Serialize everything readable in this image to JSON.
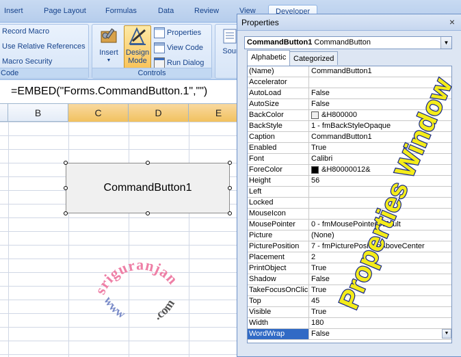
{
  "ribbon": {
    "tabs": [
      "Insert",
      "Page Layout",
      "Formulas",
      "Data",
      "Review",
      "View",
      "Developer"
    ],
    "active_tab": "Developer",
    "code_group": {
      "label": "Code",
      "record_macro": "Record Macro",
      "relative_refs": "Use Relative References",
      "macro_security": "Macro Security"
    },
    "controls_group": {
      "label": "Controls",
      "insert": "Insert",
      "design_mode_line1": "Design",
      "design_mode_line2": "Mode",
      "properties": "Properties",
      "view_code": "View Code",
      "run_dialog": "Run Dialog"
    },
    "source_partial": "Sour"
  },
  "formula_bar": {
    "formula": "=EMBED(\"Forms.CommandButton.1\",\"\")"
  },
  "columns": [
    "B",
    "C",
    "D",
    "E"
  ],
  "sheet": {
    "command_button_label": "CommandButton1",
    "watermark_top": "sriguranjani",
    "watermark_left": "www",
    "watermark_right": ".com"
  },
  "properties_window": {
    "title": "Properties",
    "close_glyph": "×",
    "object_name": "CommandButton1",
    "object_type": "CommandButton",
    "tabs": [
      "Alphabetic",
      "Categorized"
    ],
    "active_tab": "Alphabetic",
    "overlay_text": "Properties Window",
    "rows": [
      {
        "name": "(Name)",
        "value": "CommandButton1"
      },
      {
        "name": "Accelerator",
        "value": ""
      },
      {
        "name": "AutoLoad",
        "value": "False"
      },
      {
        "name": "AutoSize",
        "value": "False"
      },
      {
        "name": "BackColor",
        "value": "&H800000",
        "swatch": "#f0f0f0"
      },
      {
        "name": "BackStyle",
        "value": "1 - fmBackStyleOpaque"
      },
      {
        "name": "Caption",
        "value": "CommandButton1"
      },
      {
        "name": "Enabled",
        "value": "True"
      },
      {
        "name": "Font",
        "value": "Calibri"
      },
      {
        "name": "ForeColor",
        "value": "&H80000012&",
        "swatch": "#000000"
      },
      {
        "name": "Height",
        "value": "56"
      },
      {
        "name": "Left",
        "value": ""
      },
      {
        "name": "Locked",
        "value": ""
      },
      {
        "name": "MouseIcon",
        "value": ""
      },
      {
        "name": "MousePointer",
        "value": "0 - fmMousePointerDefault"
      },
      {
        "name": "Picture",
        "value": "(None)"
      },
      {
        "name": "PicturePosition",
        "value": "7 - fmPicturePositionAboveCenter"
      },
      {
        "name": "Placement",
        "value": "2"
      },
      {
        "name": "PrintObject",
        "value": "True"
      },
      {
        "name": "Shadow",
        "value": "False"
      },
      {
        "name": "TakeFocusOnClick",
        "value": "True"
      },
      {
        "name": "Top",
        "value": "45"
      },
      {
        "name": "Visible",
        "value": "True"
      },
      {
        "name": "Width",
        "value": "180"
      },
      {
        "name": "WordWrap",
        "value": "False",
        "selected": true
      }
    ]
  }
}
